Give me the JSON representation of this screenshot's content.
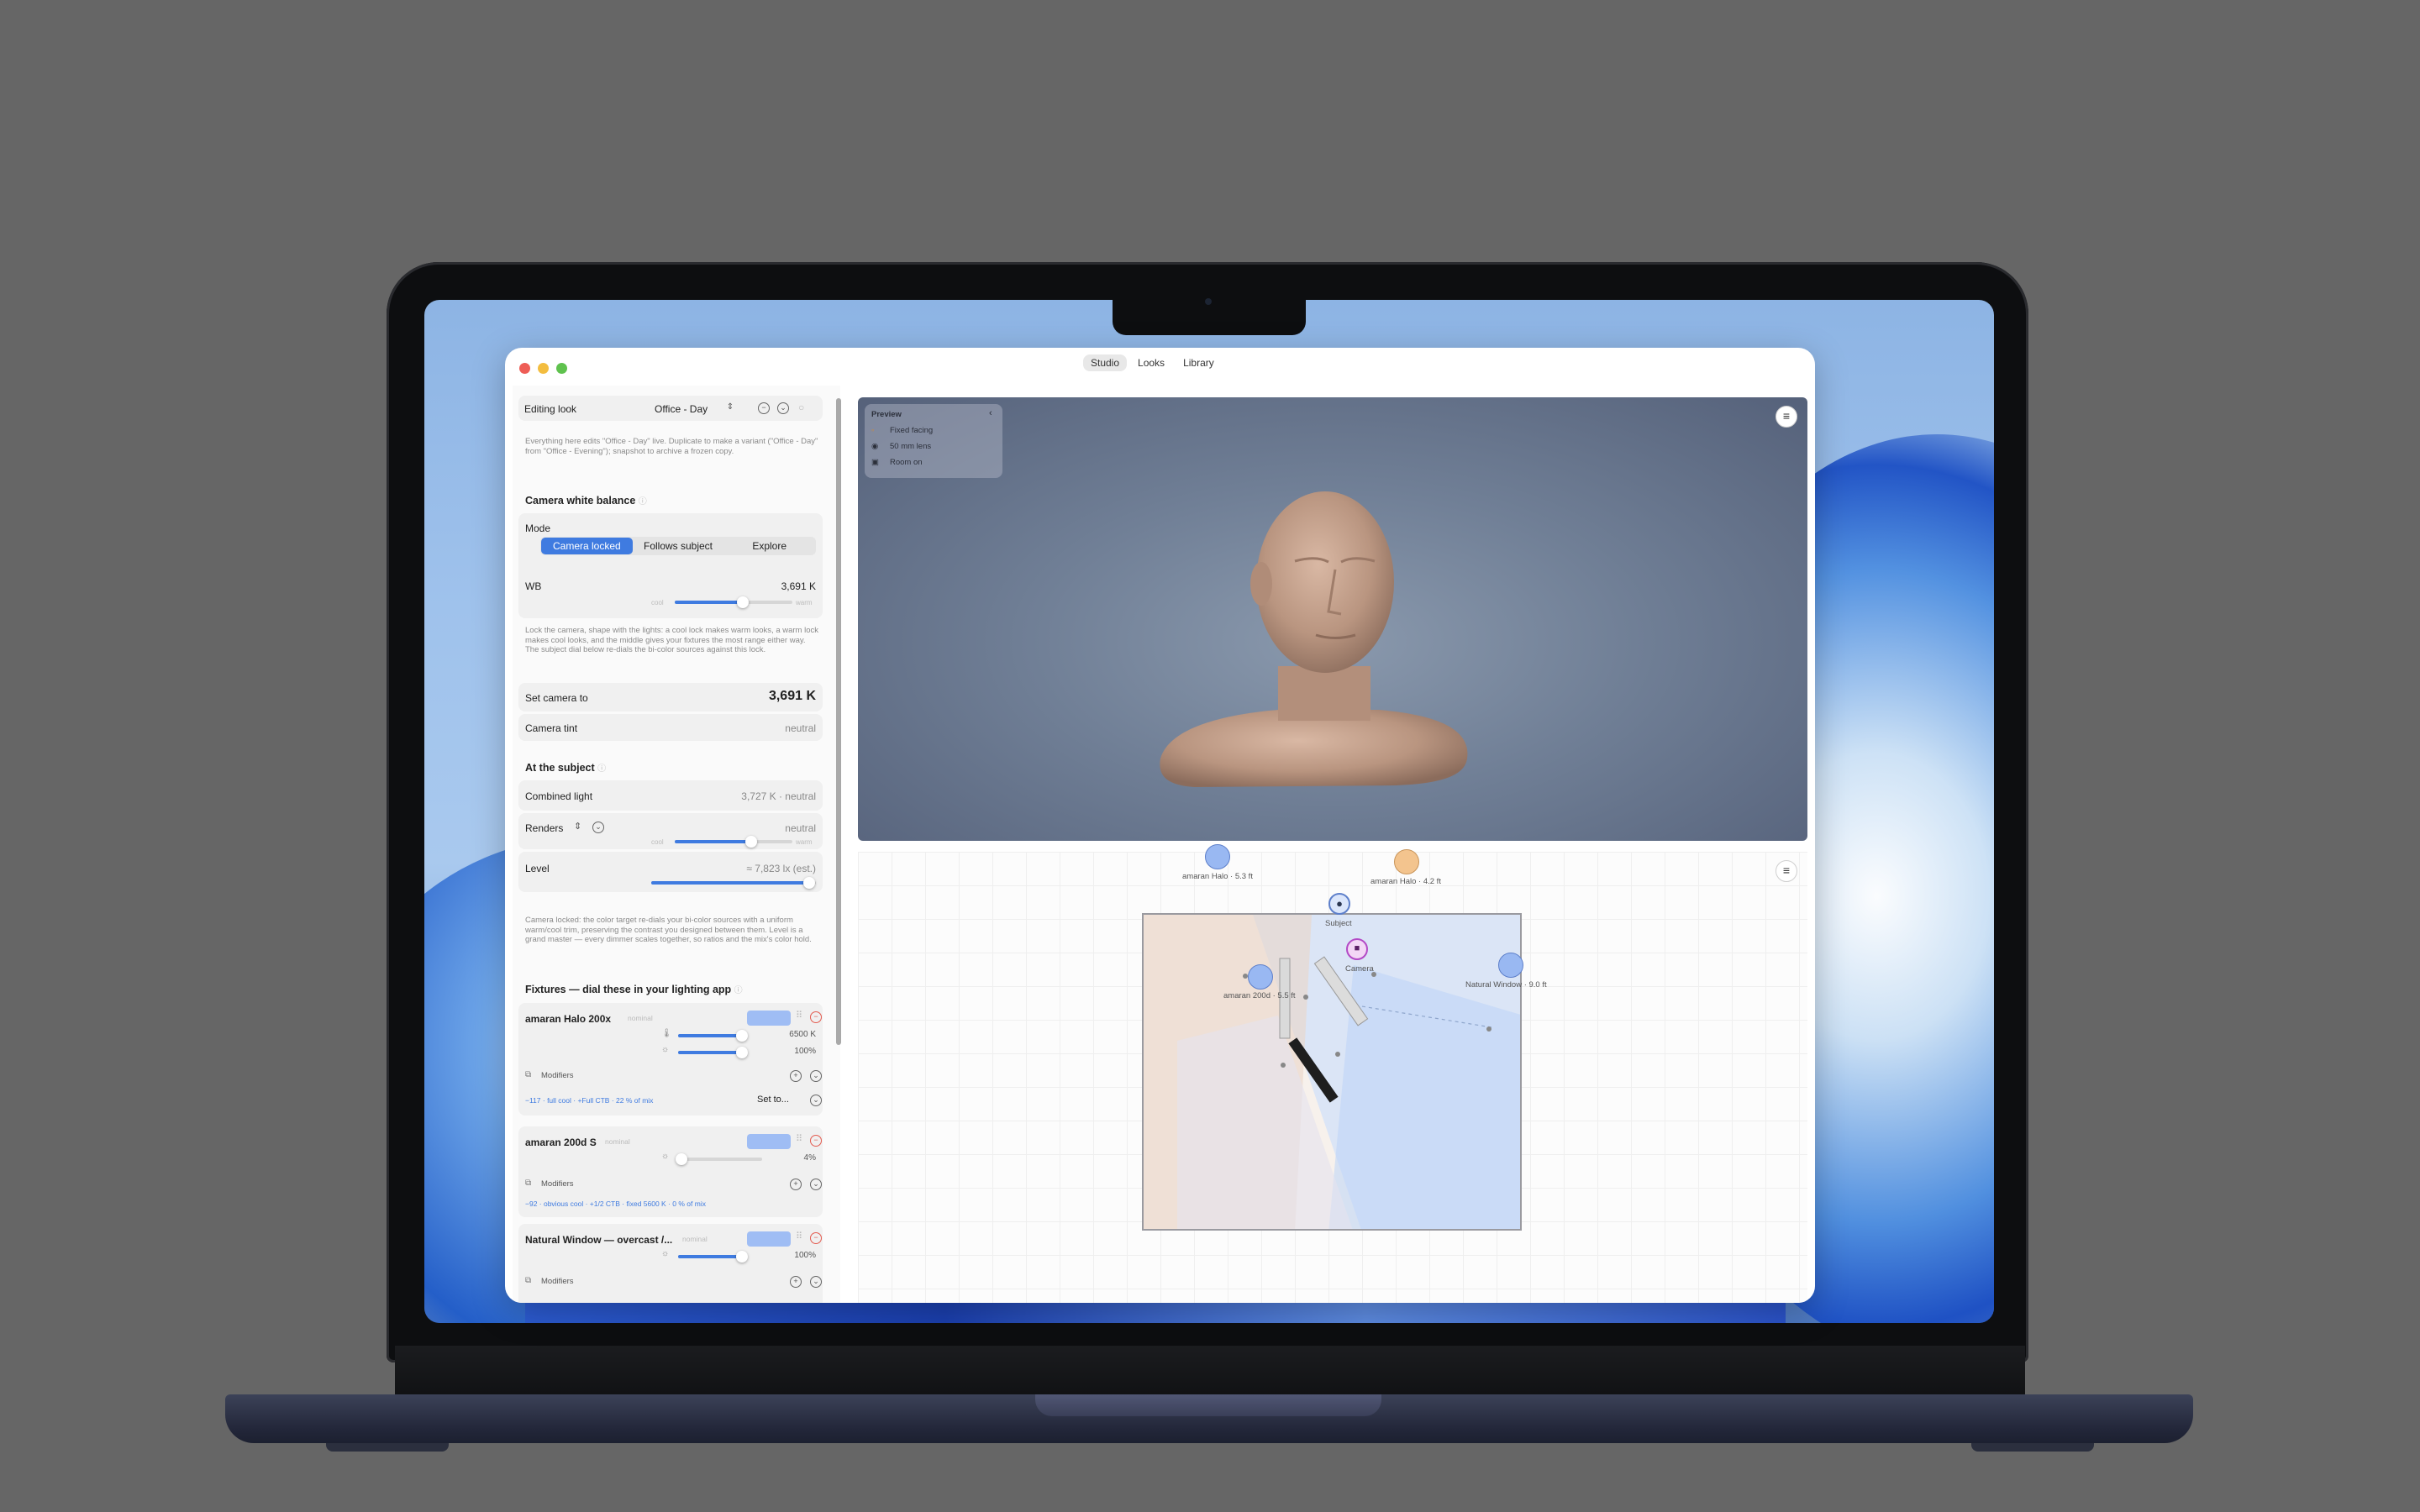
{
  "window": {
    "tabs": [
      "Studio",
      "Looks",
      "Library"
    ],
    "active_tab": "Studio"
  },
  "editing": {
    "label": "Editing look",
    "look_name": "Office - Day",
    "note": "Everything here edits \"Office - Day\" live. Duplicate to make a variant (\"Office - Day\" from \"Office - Evening\"); snapshot to archive a frozen copy."
  },
  "camera_wb": {
    "title": "Camera white balance",
    "mode_label": "Mode",
    "modes": [
      "Camera locked",
      "Follows subject",
      "Explore"
    ],
    "active_mode": "Camera locked",
    "wb_label": "WB",
    "wb_value": "3,691 K",
    "wb_position": 0.58,
    "cool": "cool",
    "warm": "warm",
    "note": "Lock the camera, shape with the lights: a cool lock makes warm looks, a warm lock makes cool looks, and the middle gives your fixtures the most range either way. The subject dial below re-dials the bi-color sources against this lock.",
    "set_label": "Set camera to",
    "set_value": "3,691 K",
    "tint_label": "Camera tint",
    "tint_value": "neutral"
  },
  "subject": {
    "title": "At the subject",
    "combined_label": "Combined light",
    "combined_value": "3,727 K · neutral",
    "renders_label": "Renders",
    "renders_value": "neutral",
    "renders_position": 0.65,
    "cool": "cool",
    "warm": "warm",
    "level_label": "Level",
    "level_value": "≈ 7,823 lx (est.)",
    "level_position": 0.96,
    "note": "Camera locked: the color target re-dials your bi-color sources with a uniform warm/cool trim, preserving the contrast you designed between them. Level is a grand master — every dimmer scales together, so ratios and the mix's color hold."
  },
  "fixtures": {
    "title": "Fixtures — dial these in your lighting app",
    "items": [
      {
        "name": "amaran Halo 200x",
        "tag": "nominal",
        "cct": "6500 K",
        "cct_position": 0.95,
        "dim": "100%",
        "dim_position": 0.95,
        "modifiers": "Modifiers",
        "summary": "−117 · full cool · +Full CTB · 22 % of mix",
        "set_to": "Set to..."
      },
      {
        "name": "amaran 200d S",
        "tag": "nominal",
        "dim": "4%",
        "dim_position": 0.04,
        "modifiers": "Modifiers",
        "summary": "−92 · obvious cool · +1/2 CTB · fixed 5600 K · 0 % of mix"
      },
      {
        "name": "Natural Window — overcast /...",
        "tag": "nominal",
        "dim": "100%",
        "dim_position": 0.95,
        "modifiers": "Modifiers"
      }
    ]
  },
  "preview": {
    "title": "Preview",
    "items": [
      "Fixed facing",
      "50 mm lens",
      "Room on"
    ]
  },
  "plan": {
    "labels": {
      "halo_left": "amaran Halo · 5.3 ft",
      "halo_right": "amaran Halo · 4.2 ft",
      "subject": "Subject",
      "camera": "Camera",
      "window": "Natural Window · 9.0 ft",
      "d200": "amaran 200d · 5.5 ft"
    }
  },
  "colors": {
    "accent": "#3f7be0",
    "desktop_bg": "#666666",
    "viewport_bg": "#707f96"
  }
}
